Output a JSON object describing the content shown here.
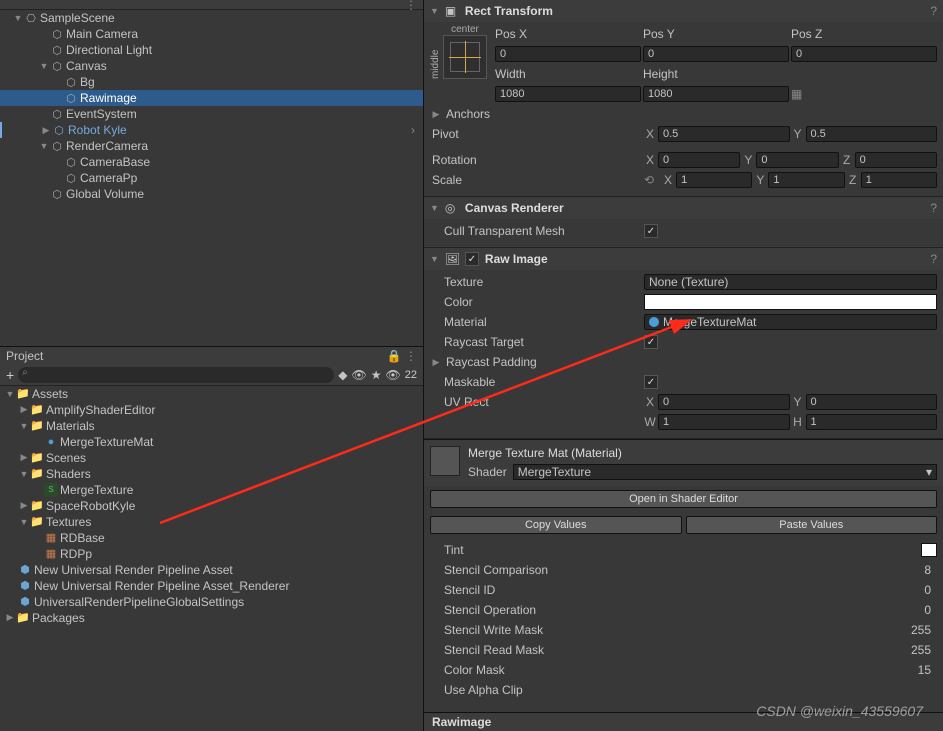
{
  "hierarchy": {
    "scene": "SampleScene",
    "items": [
      "Main Camera",
      "Directional Light",
      "Canvas",
      "Bg",
      "Rawimage",
      "EventSystem",
      "Robot Kyle",
      "RenderCamera",
      "CameraBase",
      "CameraPp",
      "Global Volume"
    ]
  },
  "project": {
    "tab": "Project",
    "search_placeholder": "",
    "count": "22",
    "root": "Assets",
    "items": [
      "AmplifyShaderEditor",
      "Materials",
      "MergeTextureMat",
      "Scenes",
      "Shaders",
      "MergeTexture",
      "SpaceRobotKyle",
      "Textures",
      "RDBase",
      "RDPp",
      "New Universal Render Pipeline Asset",
      "New Universal Render Pipeline Asset_Renderer",
      "UniversalRenderPipelineGlobalSettings"
    ],
    "packages": "Packages"
  },
  "rect_transform": {
    "title": "Rect Transform",
    "anchor_label": "center",
    "middle_label": "middle",
    "posx_label": "Pos X",
    "posx": "0",
    "posy_label": "Pos Y",
    "posy": "0",
    "posz_label": "Pos Z",
    "posz": "0",
    "width_label": "Width",
    "width": "1080",
    "height_label": "Height",
    "height": "1080",
    "anchors": "Anchors",
    "pivot": "Pivot",
    "pivot_x": "0.5",
    "pivot_y": "0.5",
    "rotation": "Rotation",
    "rot_x": "0",
    "rot_y": "0",
    "rot_z": "0",
    "scale": "Scale",
    "scale_x": "1",
    "scale_y": "1",
    "scale_z": "1"
  },
  "canvas_renderer": {
    "title": "Canvas Renderer",
    "cull": "Cull Transparent Mesh"
  },
  "raw_image": {
    "title": "Raw Image",
    "texture": "Texture",
    "texture_val": "None (Texture)",
    "color": "Color",
    "material": "Material",
    "material_val": "MergeTextureMat",
    "raycast": "Raycast Target",
    "raycast_padding": "Raycast Padding",
    "maskable": "Maskable",
    "uv_rect": "UV Rect",
    "uv_x": "0",
    "uv_y": "0",
    "uv_w": "1",
    "uv_h": "1"
  },
  "material": {
    "title": "Merge Texture Mat (Material)",
    "shader_label": "Shader",
    "shader": "MergeTexture",
    "open_btn": "Open in Shader Editor",
    "copy_btn": "Copy Values",
    "paste_btn": "Paste Values",
    "props": [
      {
        "label": "Tint",
        "val": ""
      },
      {
        "label": "Stencil Comparison",
        "val": "8"
      },
      {
        "label": "Stencil ID",
        "val": "0"
      },
      {
        "label": "Stencil Operation",
        "val": "0"
      },
      {
        "label": "Stencil Write Mask",
        "val": "255"
      },
      {
        "label": "Stencil Read Mask",
        "val": "255"
      },
      {
        "label": "Color Mask",
        "val": "15"
      },
      {
        "label": "Use Alpha Clip",
        "val": ""
      }
    ]
  },
  "bottom_tab": "Rawimage",
  "watermark": "CSDN @weixin_43559607"
}
